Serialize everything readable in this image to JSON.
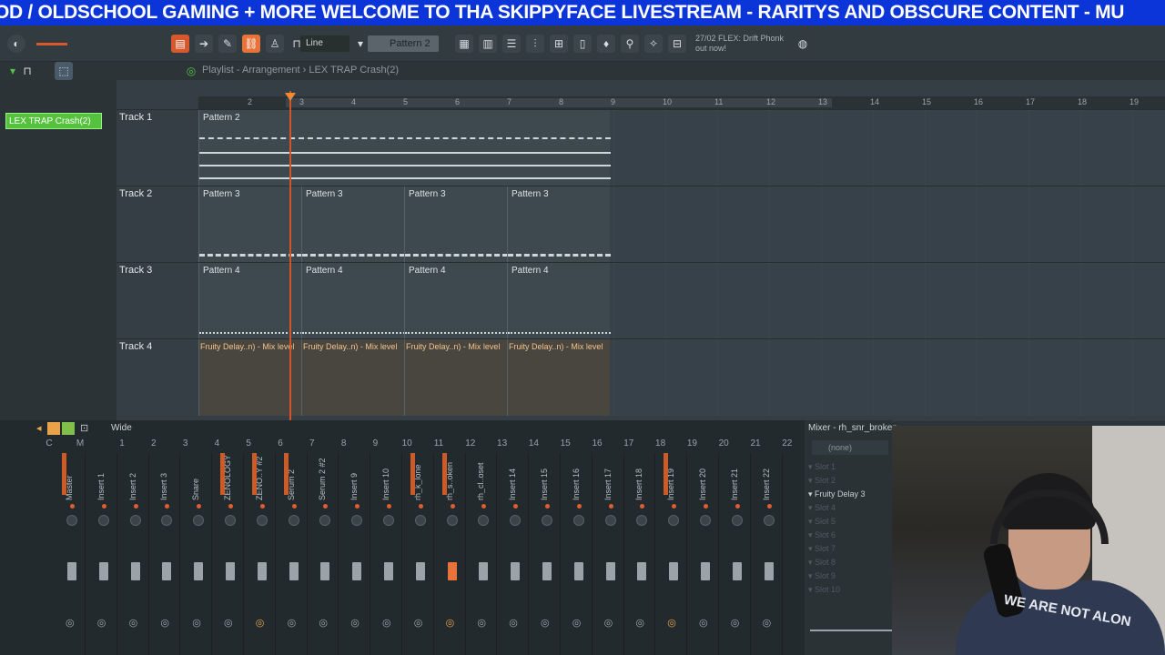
{
  "ticker": {
    "text": "OD / OLDSCHOOL GAMING + MORE  WELCOME TO THA SKIPPYFACE LIVESTREAM  - RARITYS AND OBSCURE CONTENT - MU"
  },
  "toolbar": {
    "snap_mode": "Line",
    "pattern_selector": "Pattern 2",
    "news_line1": "27/02  FLEX: Drift Phonk",
    "news_line2": "out now!"
  },
  "playlist": {
    "title": "Playlist - Arrangement › LEX TRAP Crash(2)",
    "selected_clip": "LEX TRAP Crash(2)",
    "ruler": [
      "2",
      "3",
      "4",
      "5",
      "6",
      "7",
      "8",
      "9",
      "10",
      "11",
      "12",
      "13",
      "14",
      "15",
      "16",
      "17",
      "18",
      "19"
    ],
    "tracks": [
      {
        "name": "Track 1",
        "blocks": [
          "Pattern 2"
        ]
      },
      {
        "name": "Track 2",
        "blocks": [
          "Pattern 3",
          "Pattern 3",
          "Pattern 3",
          "Pattern 3"
        ]
      },
      {
        "name": "Track 3",
        "blocks": [
          "Pattern 4",
          "Pattern 4",
          "Pattern 4",
          "Pattern 4"
        ]
      },
      {
        "name": "Track 4",
        "blocks": [
          "Fruity Delay..n) - Mix level",
          "Fruity Delay..n) - Mix level",
          "Fruity Delay..n) - Mix level",
          "Fruity Delay..n) - Mix level"
        ]
      }
    ]
  },
  "mixer": {
    "view_mode": "Wide",
    "numbers": [
      "C",
      "M",
      "1",
      "2",
      "3",
      "4",
      "5",
      "6",
      "7",
      "8",
      "9",
      "10",
      "11",
      "12",
      "13",
      "14",
      "15",
      "16",
      "17",
      "18",
      "19",
      "20",
      "21",
      "22"
    ],
    "channels": [
      "Master",
      "Insert 1",
      "Insert 2",
      "Insert 3",
      "Snare",
      "ZENOLOGY",
      "ZENO..Y #2",
      "Serum 2",
      "Serum 2 #2",
      "Insert 9",
      "Insert 10",
      "rh_k_lone",
      "rh_s..oken",
      "rh_cl..oset",
      "Insert 14",
      "Insert 15",
      "Insert 16",
      "Insert 17",
      "Insert 18",
      "Insert 19",
      "Insert 20",
      "Insert 21",
      "Insert 22"
    ],
    "rack_title": "Mixer - rh_snr_broken",
    "rack_input": "(none)",
    "slots": [
      "Slot 1",
      "Slot 2",
      "Fruity Delay 3",
      "Slot 4",
      "Slot 5",
      "Slot 6",
      "Slot 7",
      "Slot 8",
      "Slot 9",
      "Slot 10"
    ],
    "active_slot_index": 2
  },
  "webcam": {
    "shirt_text": "WE ARE NOT ALON"
  },
  "colors": {
    "accent": "#d8582d",
    "clip_green": "#54c23d",
    "ticker_bg": "#0b35d8"
  }
}
